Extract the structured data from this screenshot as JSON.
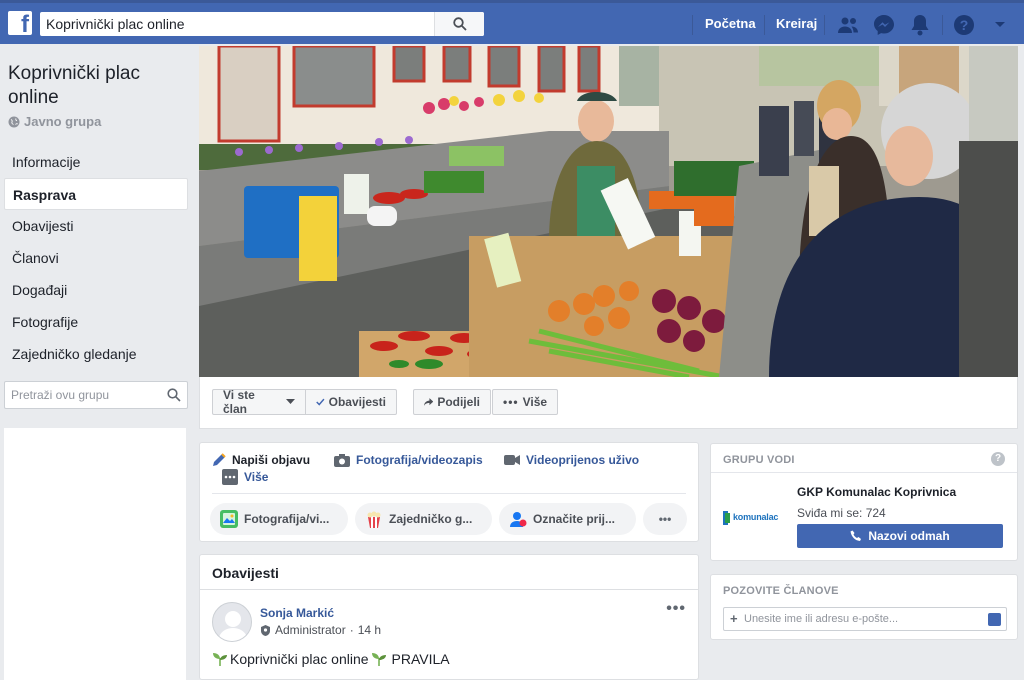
{
  "topbar": {
    "search_value": "Koprivnički plac online",
    "nav": [
      "Početna",
      "Kreiraj"
    ],
    "icons": [
      "friends-icon",
      "messenger-icon",
      "notifications-icon",
      "help-icon",
      "dropdown-caret-icon"
    ]
  },
  "group": {
    "name": "Koprivnički plac online",
    "privacy": "Javno grupa",
    "nav": [
      {
        "label": "Informacije",
        "active": false
      },
      {
        "label": "Rasprava",
        "active": true
      },
      {
        "label": "Obavijesti",
        "active": false
      },
      {
        "label": "Članovi",
        "active": false
      },
      {
        "label": "Događaji",
        "active": false
      },
      {
        "label": "Fotografije",
        "active": false
      },
      {
        "label": "Zajedničko gledanje",
        "active": false
      }
    ],
    "search_placeholder": "Pretraži ovu grupu"
  },
  "actions": {
    "member": "Vi ste član",
    "notifications": "Obavijesti",
    "share": "Podijeli",
    "more": "Više"
  },
  "composer": {
    "tabs": [
      "Napiši objavu",
      "Fotografija/videozapis",
      "Videoprijenos uživo",
      "Više"
    ],
    "pills": [
      "Fotografija/vi...",
      "Zajedničko g...",
      "Označite prij..."
    ],
    "more_dots": "•••"
  },
  "announcements": {
    "title": "Obavijesti",
    "post": {
      "author": "Sonja Markić",
      "role": "Administrator",
      "time": "14 h",
      "separator": "·",
      "text_prefix": "Koprivnički plac online",
      "text_suffix": "PRAVILA",
      "more": "•••"
    }
  },
  "admin_card": {
    "title": "GRUPU VODI",
    "help": "?",
    "name": "GKP Komunalac Koprivnica",
    "likes": "Sviđa mi se: 724",
    "call": "Nazovi odmah",
    "logo_text": "komunalac"
  },
  "invite_card": {
    "title": "POZOVITE ČLANOVE",
    "placeholder": "Unesite ime ili adresu e-pošte...",
    "plus": "+"
  },
  "colors": {
    "brand": "#4267b2",
    "link": "#365899",
    "background": "#e9ebee"
  }
}
